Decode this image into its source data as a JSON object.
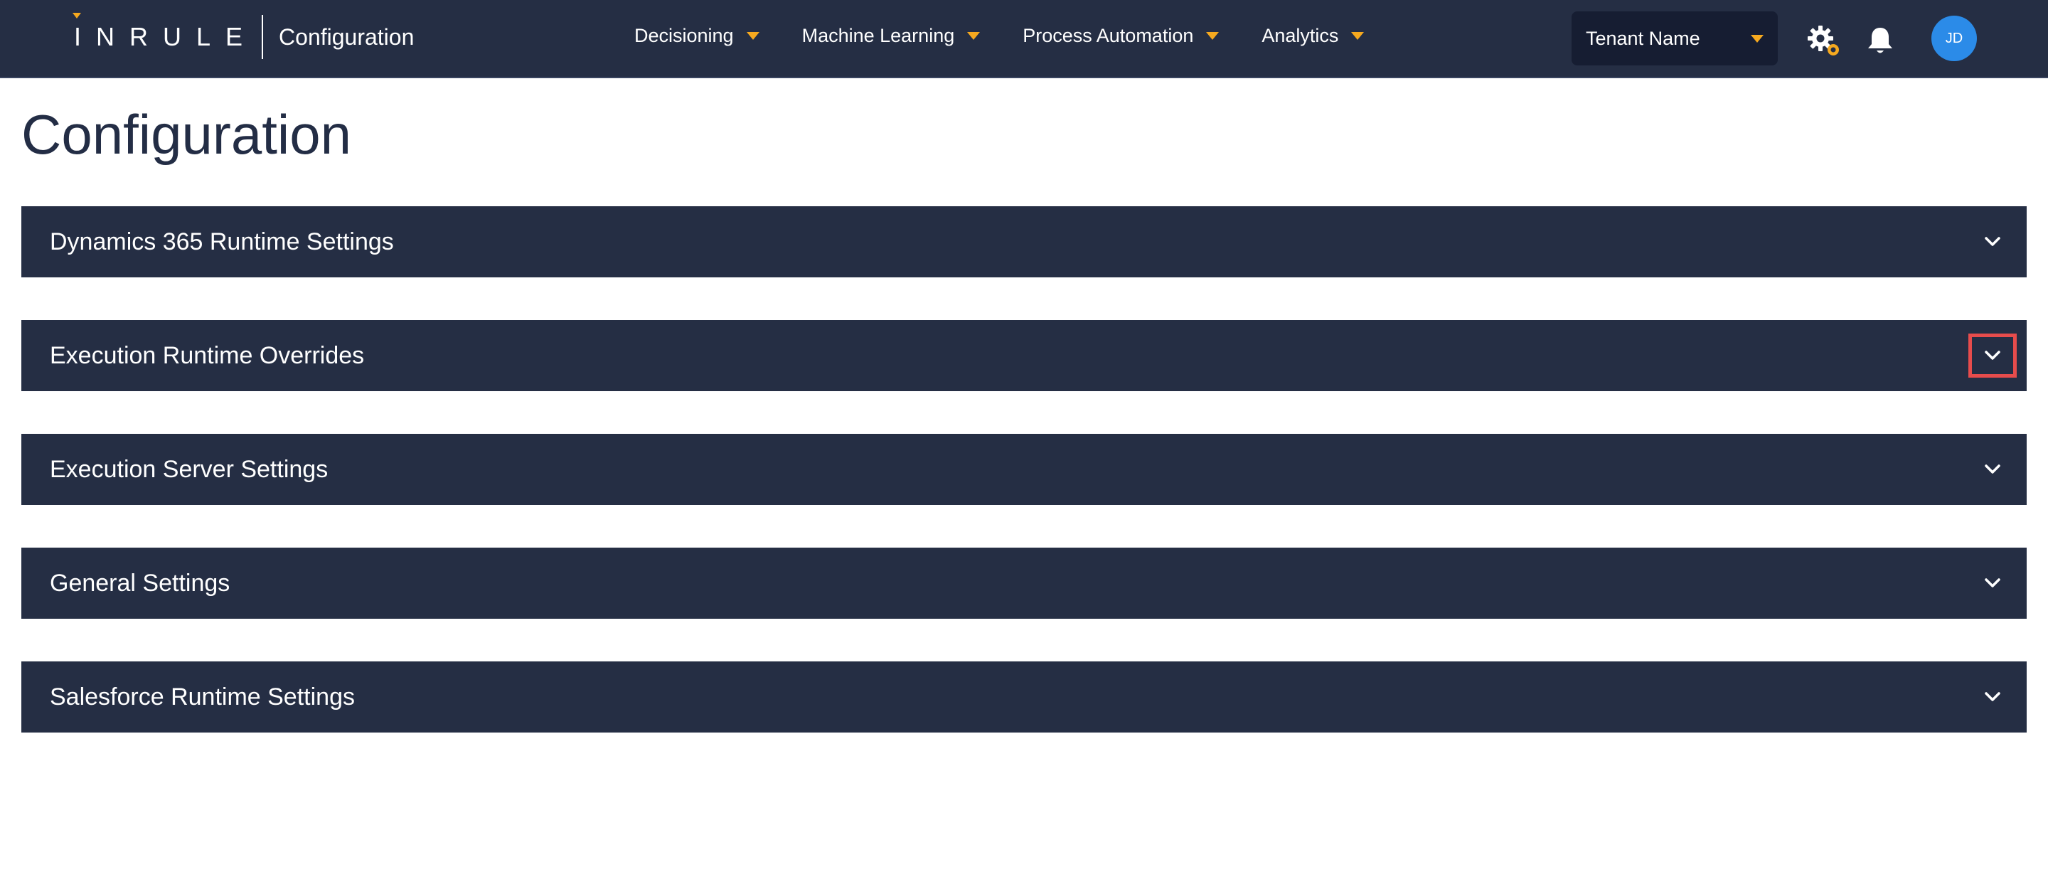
{
  "header": {
    "logo_text": "INRULE",
    "app_title": "Configuration",
    "nav": [
      {
        "label": "Decisioning"
      },
      {
        "label": "Machine Learning"
      },
      {
        "label": "Process Automation"
      },
      {
        "label": "Analytics"
      }
    ],
    "tenant": {
      "label": "Tenant Name"
    },
    "avatar_initials": "JD",
    "icons": {
      "settings": "gear-icon",
      "notifications": "bell-icon"
    },
    "accent_color": "#f6a91f"
  },
  "main": {
    "page_title": "Configuration",
    "sections": [
      {
        "title": "Dynamics 365 Runtime Settings",
        "highlighted": false
      },
      {
        "title": "Execution Runtime Overrides",
        "highlighted": true
      },
      {
        "title": "Execution Server Settings",
        "highlighted": false
      },
      {
        "title": "General Settings",
        "highlighted": false
      },
      {
        "title": "Salesforce Runtime Settings",
        "highlighted": false
      }
    ]
  },
  "colors": {
    "bar_bg": "#252e44",
    "tenant_bg": "#161d32",
    "highlight": "#e74c4c",
    "avatar_bg": "#2b8be8"
  }
}
